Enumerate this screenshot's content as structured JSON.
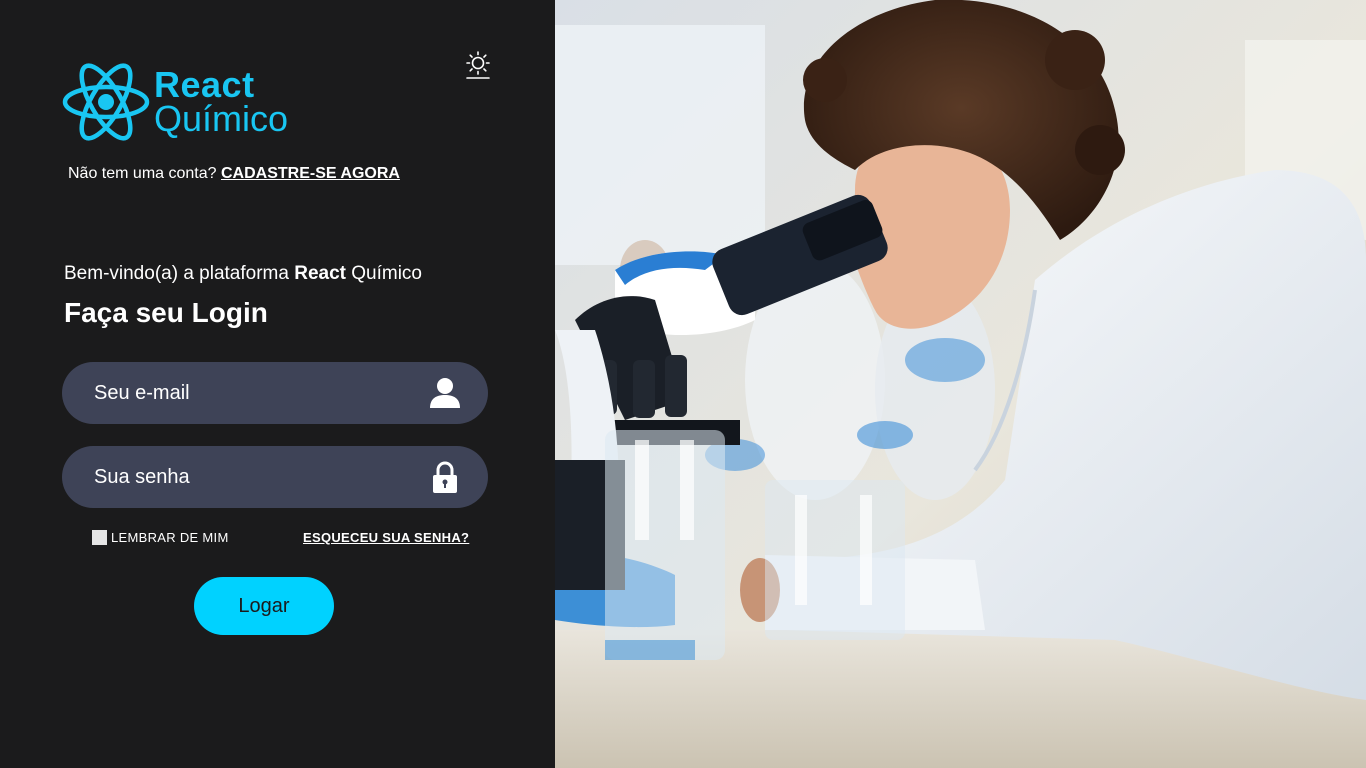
{
  "brand": {
    "name_line1": "React",
    "name_line2": "Químico",
    "color": "#19c6f2"
  },
  "theme_toggle": {
    "icon": "sun-icon"
  },
  "signup": {
    "prompt": "Não tem uma conta?",
    "link": "CADASTRE-SE AGORA"
  },
  "welcome": {
    "prefix": "Bem-vindo(a) a plataforma",
    "brand_bold": "React",
    "brand_rest": "Químico"
  },
  "login_title": "Faça seu Login",
  "form": {
    "email": {
      "placeholder": "Seu e-mail",
      "value": "",
      "icon": "user-icon"
    },
    "password": {
      "placeholder": "Sua senha",
      "value": "",
      "icon": "lock-icon"
    },
    "remember_label": "LEMBRAR DE MIM",
    "remember_checked": false,
    "forgot_label": "ESQUECEU SUA SENHA?",
    "submit_label": "Logar"
  },
  "colors": {
    "panel_bg": "#1b1b1c",
    "field_bg": "#3e4357",
    "accent": "#00d2ff"
  },
  "hero_image": {
    "subject": "scientist-microscope-photo"
  }
}
